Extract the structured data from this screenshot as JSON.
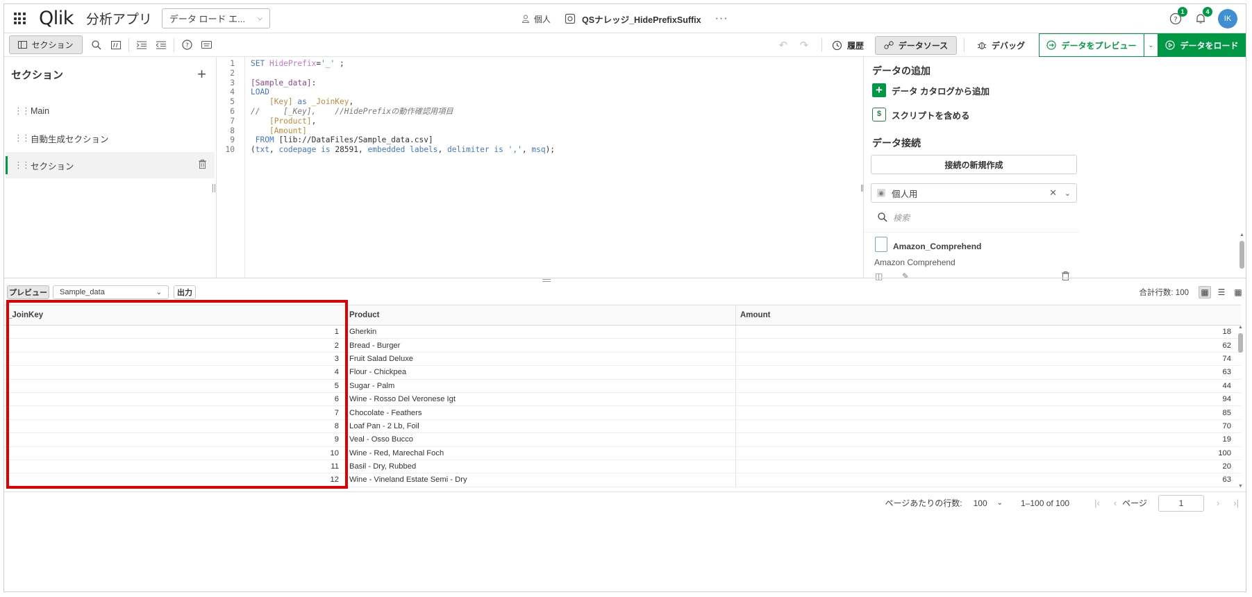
{
  "topbar": {
    "logo_text": "Qlik",
    "app_type": "分析アプリ",
    "view_dropdown": "データ ロード エ...",
    "space_label": "個人",
    "app_name": "QSナレッジ_HidePrefixSuffix",
    "more": "···",
    "help_badge": "1",
    "notif_badge": "4",
    "avatar_initials": "IK"
  },
  "toolbar": {
    "section_toggle": "セクション",
    "history": "履歴",
    "data_sources": "データソース",
    "debug": "デバッグ",
    "preview_data": "データをプレビュー",
    "load_data": "データをロード"
  },
  "sections_panel": {
    "title": "セクション",
    "items": [
      {
        "label": "Main",
        "active": false
      },
      {
        "label": "自動生成セクション",
        "active": false
      },
      {
        "label": "セクション",
        "active": true
      }
    ]
  },
  "editor": {
    "line_numbers": [
      "1",
      "2",
      "3",
      "4",
      "5",
      "6",
      "7",
      "8",
      "9",
      "10"
    ]
  },
  "data_panel": {
    "add_data_title": "データの追加",
    "add_from_catalog": "データ カタログから追加",
    "include_script": "スクリプトを含める",
    "connections_title": "データ接続",
    "new_connection": "接続の新規作成",
    "space_select": "個人用",
    "search_placeholder": "検索",
    "connection_name": "Amazon_Comprehend",
    "connection_type": "Amazon Comprehend"
  },
  "preview": {
    "preview_button": "プレビュー",
    "table_select": "Sample_data",
    "output_button": "出力",
    "total_rows": "合計行数: 100"
  },
  "table": {
    "columns": [
      "_JoinKey",
      "Product",
      "Amount"
    ],
    "rows": [
      [
        "1",
        "Gherkin",
        "18"
      ],
      [
        "2",
        "Bread - Burger",
        "62"
      ],
      [
        "3",
        "Fruit Salad Deluxe",
        "74"
      ],
      [
        "4",
        "Flour - Chickpea",
        "63"
      ],
      [
        "5",
        "Sugar - Palm",
        "44"
      ],
      [
        "6",
        "Wine - Rosso Del Veronese Igt",
        "94"
      ],
      [
        "7",
        "Chocolate - Feathers",
        "85"
      ],
      [
        "8",
        "Loaf Pan - 2 Lb, Foil",
        "70"
      ],
      [
        "9",
        "Veal - Osso Bucco",
        "19"
      ],
      [
        "10",
        "Wine - Red, Marechal Foch",
        "100"
      ],
      [
        "11",
        "Basil - Dry, Rubbed",
        "20"
      ],
      [
        "12",
        "Wine - Vineland Estate Semi - Dry",
        "63"
      ]
    ]
  },
  "footer": {
    "rows_per_page_label": "ページあたりの行数:",
    "rows_per_page": "100",
    "range": "1–100 of 100",
    "page_label": "ページ",
    "page_value": "1"
  },
  "colors": {
    "brand_green": "#009845",
    "highlight_red": "#e00000"
  }
}
